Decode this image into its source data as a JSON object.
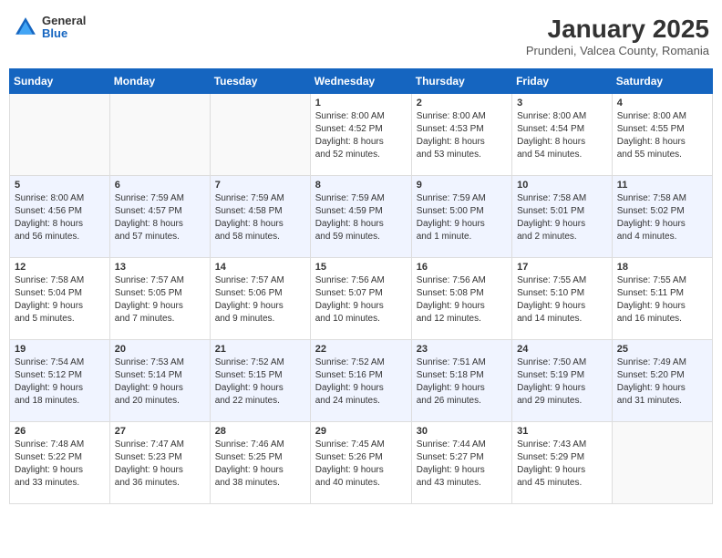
{
  "header": {
    "logo_general": "General",
    "logo_blue": "Blue",
    "title": "January 2025",
    "subtitle": "Prundeni, Valcea County, Romania"
  },
  "weekdays": [
    "Sunday",
    "Monday",
    "Tuesday",
    "Wednesday",
    "Thursday",
    "Friday",
    "Saturday"
  ],
  "weeks": [
    [
      {
        "day": "",
        "detail": ""
      },
      {
        "day": "",
        "detail": ""
      },
      {
        "day": "",
        "detail": ""
      },
      {
        "day": "1",
        "detail": "Sunrise: 8:00 AM\nSunset: 4:52 PM\nDaylight: 8 hours\nand 52 minutes."
      },
      {
        "day": "2",
        "detail": "Sunrise: 8:00 AM\nSunset: 4:53 PM\nDaylight: 8 hours\nand 53 minutes."
      },
      {
        "day": "3",
        "detail": "Sunrise: 8:00 AM\nSunset: 4:54 PM\nDaylight: 8 hours\nand 54 minutes."
      },
      {
        "day": "4",
        "detail": "Sunrise: 8:00 AM\nSunset: 4:55 PM\nDaylight: 8 hours\nand 55 minutes."
      }
    ],
    [
      {
        "day": "5",
        "detail": "Sunrise: 8:00 AM\nSunset: 4:56 PM\nDaylight: 8 hours\nand 56 minutes."
      },
      {
        "day": "6",
        "detail": "Sunrise: 7:59 AM\nSunset: 4:57 PM\nDaylight: 8 hours\nand 57 minutes."
      },
      {
        "day": "7",
        "detail": "Sunrise: 7:59 AM\nSunset: 4:58 PM\nDaylight: 8 hours\nand 58 minutes."
      },
      {
        "day": "8",
        "detail": "Sunrise: 7:59 AM\nSunset: 4:59 PM\nDaylight: 8 hours\nand 59 minutes."
      },
      {
        "day": "9",
        "detail": "Sunrise: 7:59 AM\nSunset: 5:00 PM\nDaylight: 9 hours\nand 1 minute."
      },
      {
        "day": "10",
        "detail": "Sunrise: 7:58 AM\nSunset: 5:01 PM\nDaylight: 9 hours\nand 2 minutes."
      },
      {
        "day": "11",
        "detail": "Sunrise: 7:58 AM\nSunset: 5:02 PM\nDaylight: 9 hours\nand 4 minutes."
      }
    ],
    [
      {
        "day": "12",
        "detail": "Sunrise: 7:58 AM\nSunset: 5:04 PM\nDaylight: 9 hours\nand 5 minutes."
      },
      {
        "day": "13",
        "detail": "Sunrise: 7:57 AM\nSunset: 5:05 PM\nDaylight: 9 hours\nand 7 minutes."
      },
      {
        "day": "14",
        "detail": "Sunrise: 7:57 AM\nSunset: 5:06 PM\nDaylight: 9 hours\nand 9 minutes."
      },
      {
        "day": "15",
        "detail": "Sunrise: 7:56 AM\nSunset: 5:07 PM\nDaylight: 9 hours\nand 10 minutes."
      },
      {
        "day": "16",
        "detail": "Sunrise: 7:56 AM\nSunset: 5:08 PM\nDaylight: 9 hours\nand 12 minutes."
      },
      {
        "day": "17",
        "detail": "Sunrise: 7:55 AM\nSunset: 5:10 PM\nDaylight: 9 hours\nand 14 minutes."
      },
      {
        "day": "18",
        "detail": "Sunrise: 7:55 AM\nSunset: 5:11 PM\nDaylight: 9 hours\nand 16 minutes."
      }
    ],
    [
      {
        "day": "19",
        "detail": "Sunrise: 7:54 AM\nSunset: 5:12 PM\nDaylight: 9 hours\nand 18 minutes."
      },
      {
        "day": "20",
        "detail": "Sunrise: 7:53 AM\nSunset: 5:14 PM\nDaylight: 9 hours\nand 20 minutes."
      },
      {
        "day": "21",
        "detail": "Sunrise: 7:52 AM\nSunset: 5:15 PM\nDaylight: 9 hours\nand 22 minutes."
      },
      {
        "day": "22",
        "detail": "Sunrise: 7:52 AM\nSunset: 5:16 PM\nDaylight: 9 hours\nand 24 minutes."
      },
      {
        "day": "23",
        "detail": "Sunrise: 7:51 AM\nSunset: 5:18 PM\nDaylight: 9 hours\nand 26 minutes."
      },
      {
        "day": "24",
        "detail": "Sunrise: 7:50 AM\nSunset: 5:19 PM\nDaylight: 9 hours\nand 29 minutes."
      },
      {
        "day": "25",
        "detail": "Sunrise: 7:49 AM\nSunset: 5:20 PM\nDaylight: 9 hours\nand 31 minutes."
      }
    ],
    [
      {
        "day": "26",
        "detail": "Sunrise: 7:48 AM\nSunset: 5:22 PM\nDaylight: 9 hours\nand 33 minutes."
      },
      {
        "day": "27",
        "detail": "Sunrise: 7:47 AM\nSunset: 5:23 PM\nDaylight: 9 hours\nand 36 minutes."
      },
      {
        "day": "28",
        "detail": "Sunrise: 7:46 AM\nSunset: 5:25 PM\nDaylight: 9 hours\nand 38 minutes."
      },
      {
        "day": "29",
        "detail": "Sunrise: 7:45 AM\nSunset: 5:26 PM\nDaylight: 9 hours\nand 40 minutes."
      },
      {
        "day": "30",
        "detail": "Sunrise: 7:44 AM\nSunset: 5:27 PM\nDaylight: 9 hours\nand 43 minutes."
      },
      {
        "day": "31",
        "detail": "Sunrise: 7:43 AM\nSunset: 5:29 PM\nDaylight: 9 hours\nand 45 minutes."
      },
      {
        "day": "",
        "detail": ""
      }
    ]
  ]
}
